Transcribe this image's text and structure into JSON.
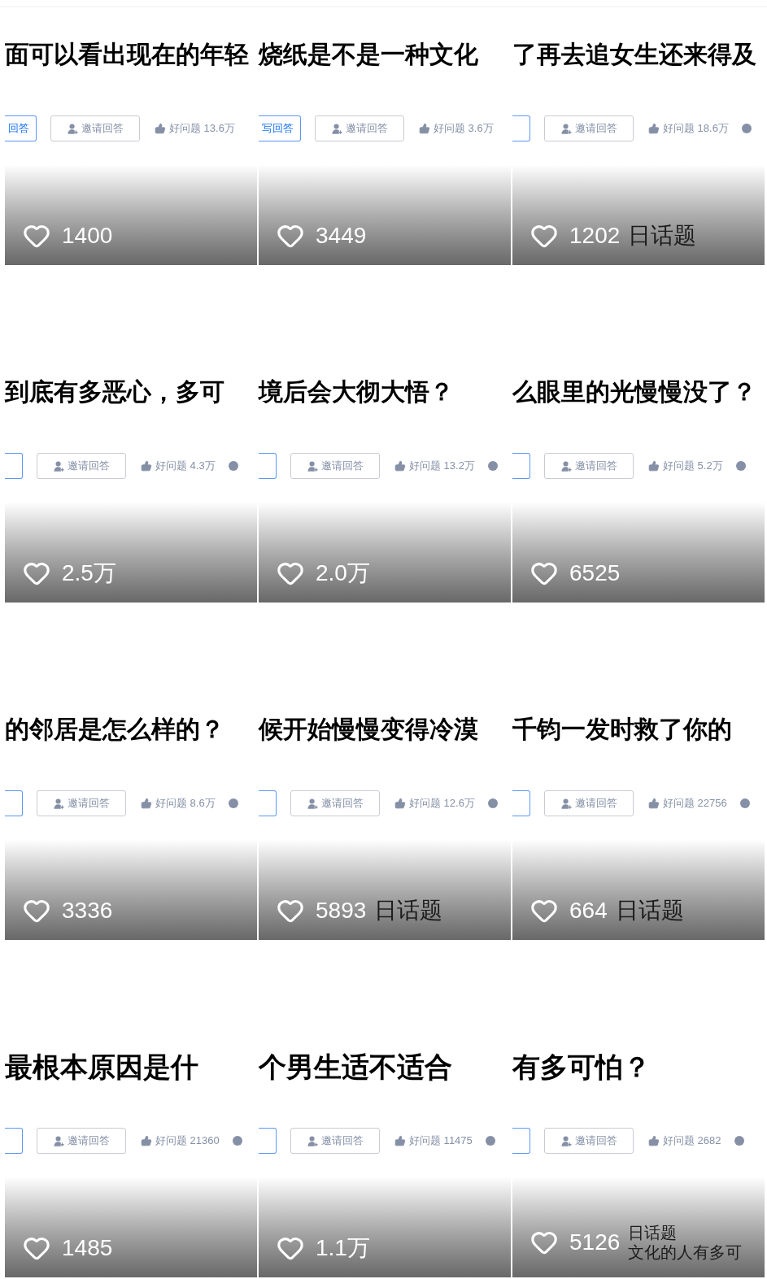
{
  "tiles": [
    {
      "title": "面可以看出现在的年轻",
      "answer_button": {
        "label": "回答"
      },
      "invite_button": {
        "label": "邀请回答"
      },
      "good_question": "好问题 13.6万",
      "comment_icon": false,
      "likes": "1400"
    },
    {
      "title": "烧纸是不是一种文化",
      "answer_button": {
        "label": "写回答"
      },
      "invite_button": {
        "label": "邀请回答"
      },
      "good_question": "好问题 3.6万",
      "comment_icon": false,
      "likes": "3449"
    },
    {
      "title": "了再去追女生还来得及",
      "invite_button": {
        "label": "邀请回答"
      },
      "good_question": "好问题 18.6万",
      "comment_icon": true,
      "likes": "1202",
      "caption": [
        "日话题"
      ]
    },
    {
      "title": "到底有多恶心，多可",
      "invite_button": {
        "label": "邀请回答"
      },
      "good_question": "好问题 4.3万",
      "comment_icon": true,
      "likes": "2.5万"
    },
    {
      "title": "境后会大彻大悟？",
      "invite_button": {
        "label": "邀请回答"
      },
      "good_question": "好问题 13.2万",
      "comment_icon": true,
      "likes": "2.0万"
    },
    {
      "title": "么眼里的光慢慢没了？",
      "invite_button": {
        "label": "邀请回答"
      },
      "good_question": "好问题 5.2万",
      "comment_icon": true,
      "likes": "6525"
    },
    {
      "title": "的邻居是怎么样的？",
      "invite_button": {
        "label": "邀请回答"
      },
      "good_question": "好问题 8.6万",
      "comment_icon": true,
      "likes": "3336"
    },
    {
      "title": "候开始慢慢变得冷漠",
      "invite_button": {
        "label": "邀请回答"
      },
      "good_question": "好问题 12.6万",
      "comment_icon": true,
      "likes": "5893",
      "caption": [
        "日话题"
      ]
    },
    {
      "title": "千钧一发时救了你的",
      "invite_button": {
        "label": "邀请回答"
      },
      "good_question": "好问题 22756",
      "comment_icon": true,
      "likes": "664",
      "caption": [
        "日话题"
      ]
    },
    {
      "title": "最根本原因是什",
      "invite_button": {
        "label": "邀请回答"
      },
      "good_question": "好问题 21360",
      "comment_icon": true,
      "likes": "1485"
    },
    {
      "title": "个男生适不适合",
      "invite_button": {
        "label": "邀请回答"
      },
      "good_question": "好问题 11475",
      "comment_icon": true,
      "likes": "1.1万"
    },
    {
      "title": "有多可怕？",
      "invite_button": {
        "label": "邀请回答"
      },
      "good_question": "好问题 2682",
      "comment_icon": true,
      "likes": "5126",
      "caption": [
        "日话题",
        "文化的人有多可"
      ]
    }
  ]
}
